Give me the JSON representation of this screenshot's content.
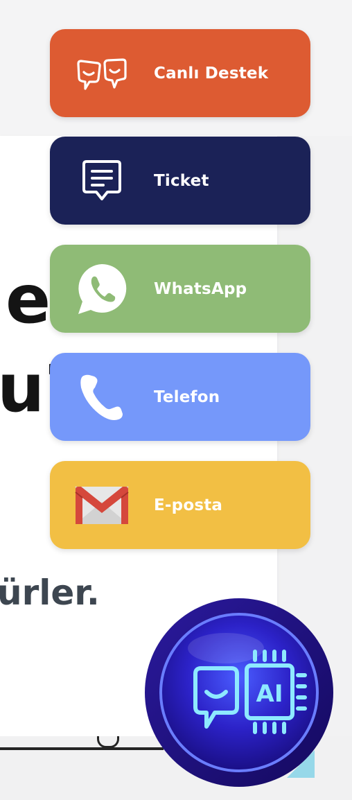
{
  "background": {
    "fragments": [
      "eta",
      "u?",
      "ürler."
    ]
  },
  "contact_menu": {
    "items": [
      {
        "label": "Canlı Destek",
        "icon": "live-chat-faces-icon",
        "color": "#dd5b32"
      },
      {
        "label": "Ticket",
        "icon": "ticket-message-icon",
        "color": "#1b2257"
      },
      {
        "label": "WhatsApp",
        "icon": "whatsapp-icon",
        "color": "#8fbb76"
      },
      {
        "label": "Telefon",
        "icon": "phone-icon",
        "color": "#7598fa"
      },
      {
        "label": "E-posta",
        "icon": "gmail-envelope-icon",
        "color": "#f2bf44"
      }
    ]
  },
  "ai_button": {
    "icon": "ai-chip-chat-icon",
    "text": "AI",
    "color": "#2a1fb3"
  }
}
